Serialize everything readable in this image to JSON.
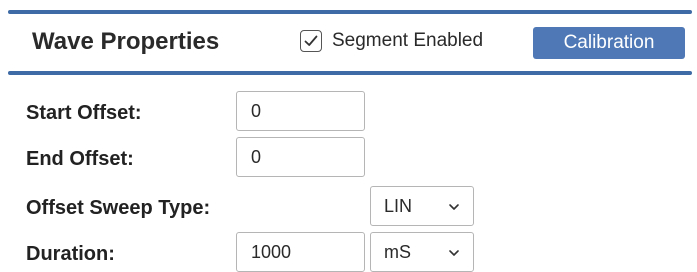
{
  "header": {
    "title": "Wave Properties",
    "segment_enabled_label": "Segment Enabled",
    "segment_enabled_checked": true,
    "calibration_label": "Calibration"
  },
  "form": {
    "start_offset": {
      "label": "Start Offset:",
      "value": "0"
    },
    "end_offset": {
      "label": "End Offset:",
      "value": "0"
    },
    "offset_sweep_type": {
      "label": "Offset Sweep Type:",
      "selected": "LIN"
    },
    "duration": {
      "label": "Duration:",
      "value": "1000",
      "unit_selected": "mS"
    }
  },
  "colors": {
    "accent_bar": "#3e6aa5",
    "button_bg": "#4f79b6"
  },
  "icons": {
    "checkbox": "check-icon",
    "dropdown": "chevron-down-icon"
  }
}
